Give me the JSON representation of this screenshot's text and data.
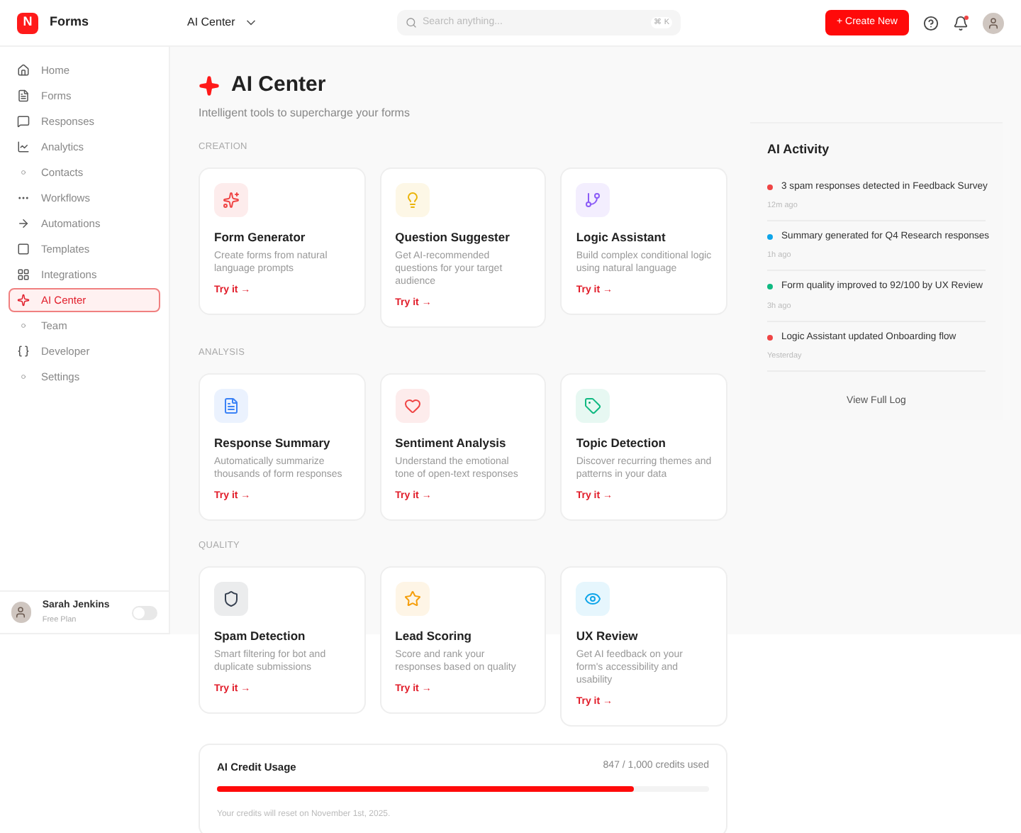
{
  "brand": {
    "logo": "N",
    "name": "Forms"
  },
  "header": {
    "breadcrumb": "AI Center",
    "search": {
      "placeholder": "Search anything...",
      "shortcut": "⌘ K"
    },
    "create_button": "+ Create New",
    "notifications": {
      "unread": true
    }
  },
  "sidebar": {
    "items": [
      {
        "label": "Home",
        "selected": false
      },
      {
        "label": "Forms",
        "selected": false
      },
      {
        "label": "Responses",
        "selected": false
      },
      {
        "label": "Analytics",
        "selected": false
      },
      {
        "label": "Contacts",
        "selected": false
      },
      {
        "label": "Workflows",
        "selected": false
      },
      {
        "label": "Automations",
        "selected": false
      },
      {
        "label": "Templates",
        "selected": false
      },
      {
        "label": "Integrations",
        "selected": false
      },
      {
        "label": "AI Center",
        "selected": true
      },
      {
        "label": "Team",
        "selected": false
      },
      {
        "label": "Developer",
        "selected": false
      },
      {
        "label": "Settings",
        "selected": false
      }
    ],
    "user": {
      "name": "Sarah Jenkins",
      "plan": "Free Plan",
      "toggle_on": false
    }
  },
  "page": {
    "title": "AI Center",
    "subtitle": "Intelligent tools to supercharge your forms"
  },
  "sections": [
    {
      "heading": "CREATION",
      "tools": [
        {
          "name": "Form Generator",
          "description": "Create forms from natural language prompts",
          "color": "#ef4444",
          "action": "Try it →"
        },
        {
          "name": "Question Suggester",
          "description": "Get AI-recommended questions for your target audience",
          "color": "#eab308",
          "action": "Try it →"
        },
        {
          "name": "Logic Assistant",
          "description": "Build complex conditional logic using natural language",
          "color": "#8b5cf6",
          "action": "Try it →"
        }
      ]
    },
    {
      "heading": "ANALYSIS",
      "tools": [
        {
          "name": "Response Summary",
          "description": "Automatically summarize thousands of form responses",
          "color": "#3b82f6",
          "action": "Try it →"
        },
        {
          "name": "Sentiment Analysis",
          "description": "Understand the emotional tone of open-text responses",
          "color": "#ef4444",
          "action": "Try it →"
        },
        {
          "name": "Topic Detection",
          "description": "Discover recurring themes and patterns in your data",
          "color": "#10b981",
          "action": "Try it →"
        }
      ]
    },
    {
      "heading": "QUALITY",
      "tools": [
        {
          "name": "Spam Detection",
          "description": "Smart filtering for bot and duplicate submissions",
          "color": "#374151",
          "action": "Try it →"
        },
        {
          "name": "Lead Scoring",
          "description": "Score and rank your responses based on quality",
          "color": "#f59e0b",
          "action": "Try it →"
        },
        {
          "name": "UX Review",
          "description": "Get AI feedback on your form's accessibility and usability",
          "color": "#0ea5e9",
          "action": "Try it →"
        }
      ]
    }
  ],
  "credits": {
    "title": "AI Credit Usage",
    "reading": "847 / 1,000 credits used",
    "level": 0.847,
    "note": "Your credits will reset on November 1st, 2025."
  },
  "activity": {
    "title": "AI Activity",
    "items": [
      {
        "text": "3 spam responses detected in Feedback Survey",
        "time": "12m ago",
        "color": "#ef4444"
      },
      {
        "text": "Summary generated for Q4 Research responses",
        "time": "1h ago",
        "color": "#0ea5e9"
      },
      {
        "text": "Form quality improved to 92/100 by UX Review",
        "time": "3h ago",
        "color": "#10b981"
      },
      {
        "text": "Logic Assistant updated Onboarding flow",
        "time": "Yesterday",
        "color": "#ef4444"
      }
    ],
    "link": "View Full Log"
  }
}
